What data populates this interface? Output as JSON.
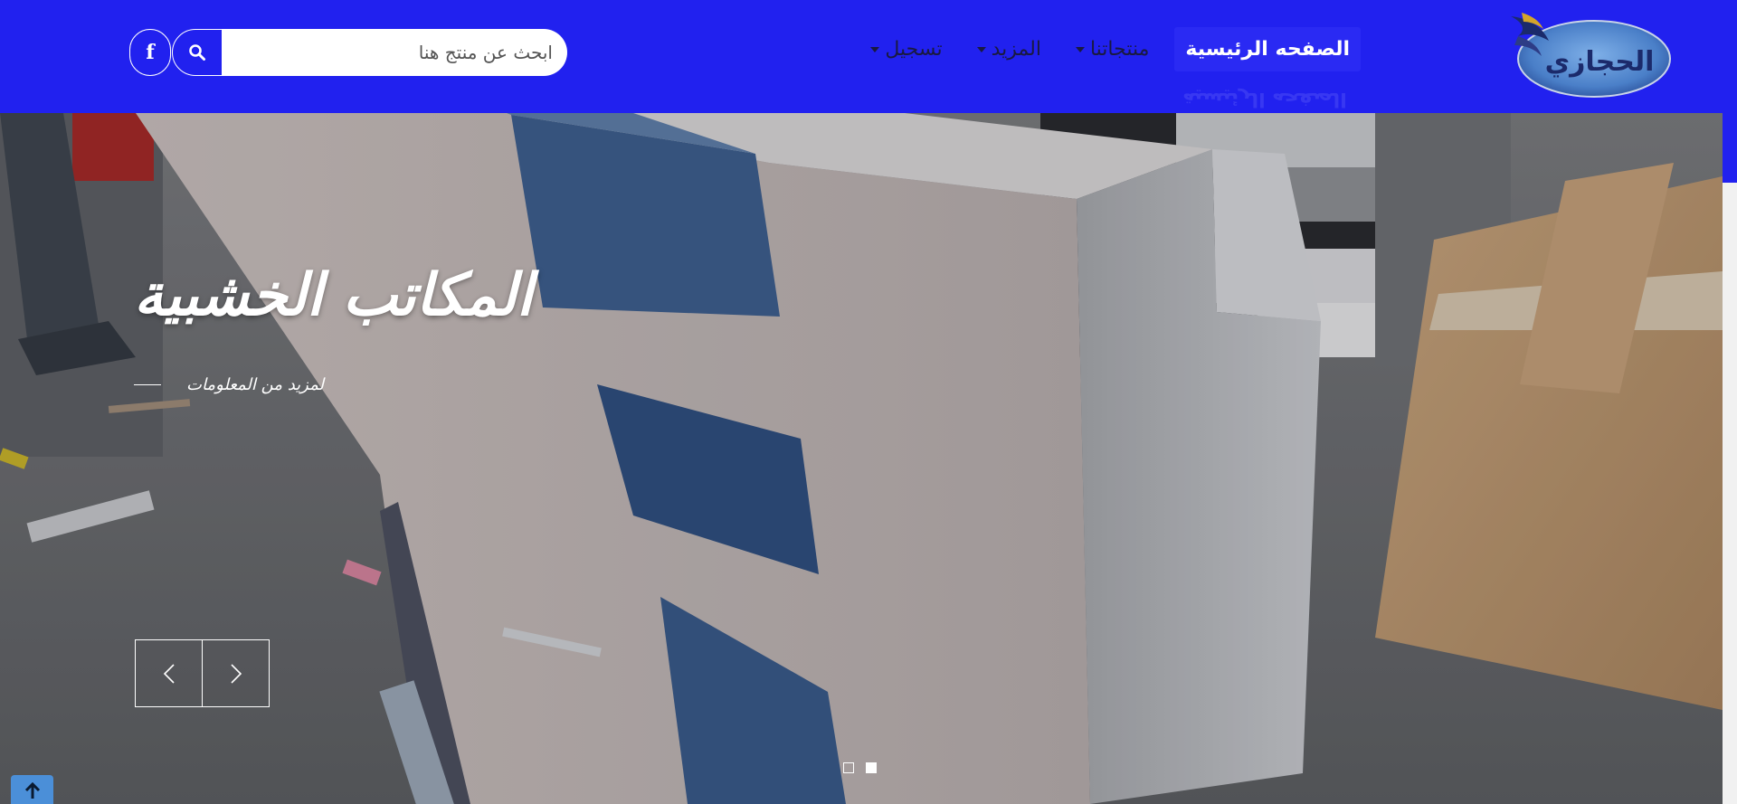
{
  "brand": {
    "logo_text": "الحجازي",
    "logo_icon": "bird-logo-icon"
  },
  "nav": {
    "items": [
      {
        "label": "الصفحه الرئيسية",
        "active": true,
        "dropdown": false
      },
      {
        "label": "منتجاتنا",
        "active": false,
        "dropdown": true
      },
      {
        "label": "المزيد",
        "active": false,
        "dropdown": true
      },
      {
        "label": "تسجيل",
        "active": false,
        "dropdown": true
      }
    ],
    "reflection_text": "الصفحه الرئيسية"
  },
  "search": {
    "placeholder": "ابحث عن منتج هنا",
    "button_icon": "search-icon"
  },
  "social": {
    "facebook_icon": "facebook-icon",
    "facebook_glyph": "f"
  },
  "hero": {
    "title": "المكاتب الخشبية",
    "more_link": "لمزيد من المعلومات",
    "prev_icon": "chevron-left-icon",
    "next_icon": "chevron-right-icon",
    "slides": 2,
    "active_slide": 2
  },
  "colors": {
    "navbar": "#2121ef",
    "active_nav": "#2a2af3",
    "back_to_top": "#4b8fd8"
  },
  "back_to_top": {
    "icon": "arrow-up-icon"
  }
}
